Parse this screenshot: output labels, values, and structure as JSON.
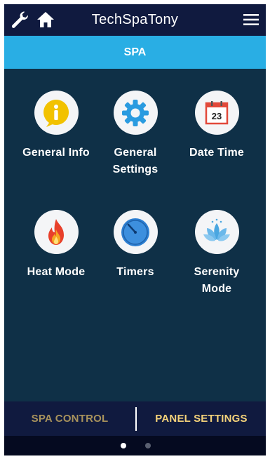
{
  "header": {
    "title": "TechSpaTony",
    "icons": [
      "wrench-icon",
      "home-icon",
      "hamburger-menu-icon"
    ]
  },
  "subheader": {
    "label": "SPA"
  },
  "tiles": [
    {
      "label": "General Info",
      "icon": "info-icon"
    },
    {
      "label": "General\nSettings",
      "icon": "gear-icon"
    },
    {
      "label": "Date Time",
      "icon": "calendar-icon",
      "calendar_day": "23"
    },
    {
      "label": "Heat Mode",
      "icon": "flame-icon"
    },
    {
      "label": "Timers",
      "icon": "timer-icon"
    },
    {
      "label": "Serenity\nMode",
      "icon": "lotus-icon"
    }
  ],
  "bottom_tabs": [
    {
      "label": "SPA CONTROL",
      "active": false
    },
    {
      "label": "PANEL SETTINGS",
      "active": true
    }
  ],
  "pager": {
    "pages": 2,
    "current": 1
  },
  "colors": {
    "background": "#0f3047",
    "topbar": "#101a3f",
    "subbar": "#29aee4",
    "tab_inactive": "#a9935c",
    "tab_active": "#f4d27a"
  }
}
